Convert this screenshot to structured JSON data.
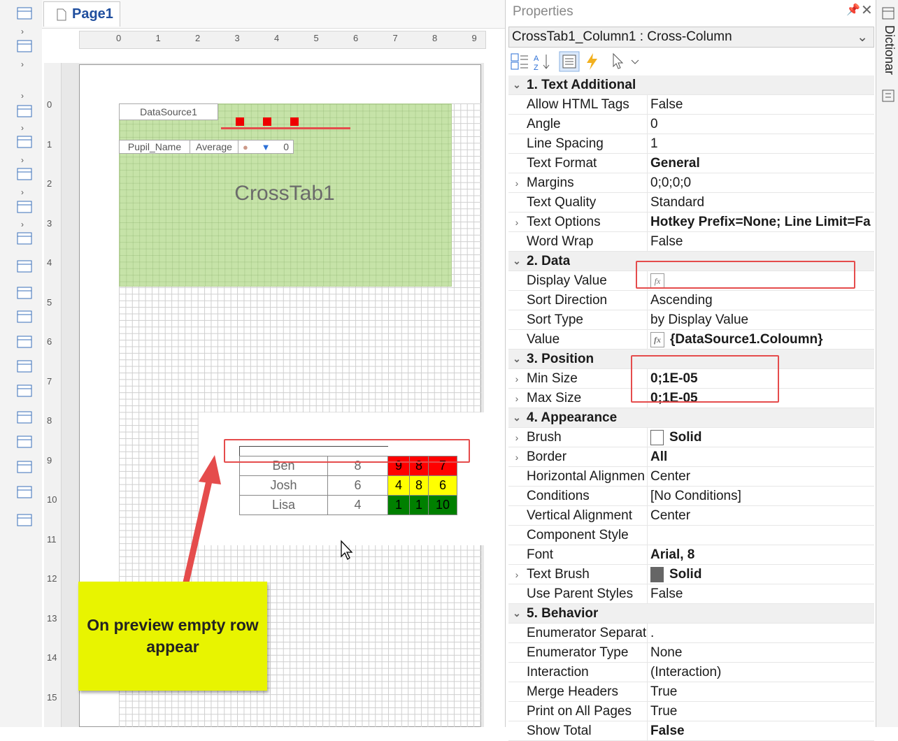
{
  "design": {
    "page_tab": "Page1",
    "hruler": [
      "0",
      "1",
      "2",
      "3",
      "4",
      "5",
      "6",
      "7",
      "8",
      "9"
    ],
    "vruler": [
      "0",
      "1",
      "2",
      "3",
      "4",
      "5",
      "6",
      "7",
      "8",
      "9",
      "10",
      "11",
      "12",
      "13",
      "14",
      "15"
    ],
    "crosstab": {
      "datasource_label": "DataSource1",
      "row_header": "Pupil_Name",
      "summary_header": "Average",
      "total_value": "0",
      "name": "CrossTab1"
    },
    "preview": {
      "rows": [
        {
          "name": "Ben",
          "avg": "8",
          "c1": "9",
          "c2": "8",
          "c3": "7"
        },
        {
          "name": "Josh",
          "avg": "6",
          "c1": "4",
          "c2": "8",
          "c3": "6"
        },
        {
          "name": "Lisa",
          "avg": "4",
          "c1": "1",
          "c2": "1",
          "c3": "10"
        }
      ]
    },
    "callout": "On preview empty row appear"
  },
  "colors": {
    "accent_red": "#e54c4c",
    "crosstab_green": "#c6e3a8",
    "cell_red": "#ff0000",
    "cell_yellow": "#ffff00",
    "cell_green": "#008000",
    "callout_yellow": "#e8f400"
  },
  "properties": {
    "title": "Properties",
    "selected": "CrossTab1_Column1 : Cross-Column",
    "dict_tab": "Dictionar",
    "rows": [
      {
        "cat": true,
        "exp": "⌄",
        "name": "1. Text  Additional",
        "value": ""
      },
      {
        "exp": "",
        "name": "Allow HTML Tags",
        "value": "False"
      },
      {
        "exp": "",
        "name": "Angle",
        "value": "0"
      },
      {
        "exp": "",
        "name": "Line Spacing",
        "value": "1"
      },
      {
        "exp": "",
        "name": "Text Format",
        "value": "General",
        "bold": true
      },
      {
        "exp": "›",
        "name": "Margins",
        "value": "0;0;0;0"
      },
      {
        "exp": "",
        "name": "Text Quality",
        "value": "Standard"
      },
      {
        "exp": "›",
        "name": "Text Options",
        "value": "Hotkey Prefix=None; Line Limit=Fa",
        "bold": true
      },
      {
        "exp": "",
        "name": "Word Wrap",
        "value": "False"
      },
      {
        "cat": true,
        "exp": "⌄",
        "name": "2. Data",
        "value": ""
      },
      {
        "exp": "",
        "name": "Display Value",
        "value": "",
        "fx": true
      },
      {
        "exp": "",
        "name": "Sort Direction",
        "value": "Ascending"
      },
      {
        "exp": "",
        "name": "Sort Type",
        "value": "by Display Value"
      },
      {
        "exp": "",
        "name": "Value",
        "value": "{DataSource1.Coloumn}",
        "fx": true,
        "bold": true
      },
      {
        "cat": true,
        "exp": "⌄",
        "name": "3. Position",
        "value": ""
      },
      {
        "exp": "›",
        "name": "Min Size",
        "value": "0;1E-05",
        "bold": true
      },
      {
        "exp": "›",
        "name": "Max Size",
        "value": "0;1E-05",
        "bold": true
      },
      {
        "cat": true,
        "exp": "⌄",
        "name": "4. Appearance",
        "value": ""
      },
      {
        "exp": "›",
        "name": "Brush",
        "value": "Solid",
        "bold": true,
        "swatch": "#ffffff"
      },
      {
        "exp": "›",
        "name": "Border",
        "value": "All",
        "bold": true
      },
      {
        "exp": "",
        "name": "Horizontal Alignmen",
        "value": "Center"
      },
      {
        "exp": "",
        "name": "Conditions",
        "value": "[No Conditions]"
      },
      {
        "exp": "",
        "name": "Vertical Alignment",
        "value": "Center"
      },
      {
        "exp": "",
        "name": "Component Style",
        "value": ""
      },
      {
        "exp": "",
        "name": "Font",
        "value": "Arial, 8",
        "bold": true
      },
      {
        "exp": "›",
        "name": "Text Brush",
        "value": "Solid",
        "bold": true,
        "swatch": "#666666"
      },
      {
        "exp": "",
        "name": "Use Parent Styles",
        "value": "False"
      },
      {
        "cat": true,
        "exp": "⌄",
        "name": "5. Behavior",
        "value": ""
      },
      {
        "exp": "",
        "name": "Enumerator Separat",
        "value": "."
      },
      {
        "exp": "",
        "name": "Enumerator Type",
        "value": "None"
      },
      {
        "exp": "",
        "name": "Interaction",
        "value": "(Interaction)"
      },
      {
        "exp": "",
        "name": "Merge Headers",
        "value": "True"
      },
      {
        "exp": "",
        "name": "Print on All Pages",
        "value": "True"
      },
      {
        "exp": "",
        "name": "Show Total",
        "value": "False",
        "bold": true
      }
    ]
  }
}
